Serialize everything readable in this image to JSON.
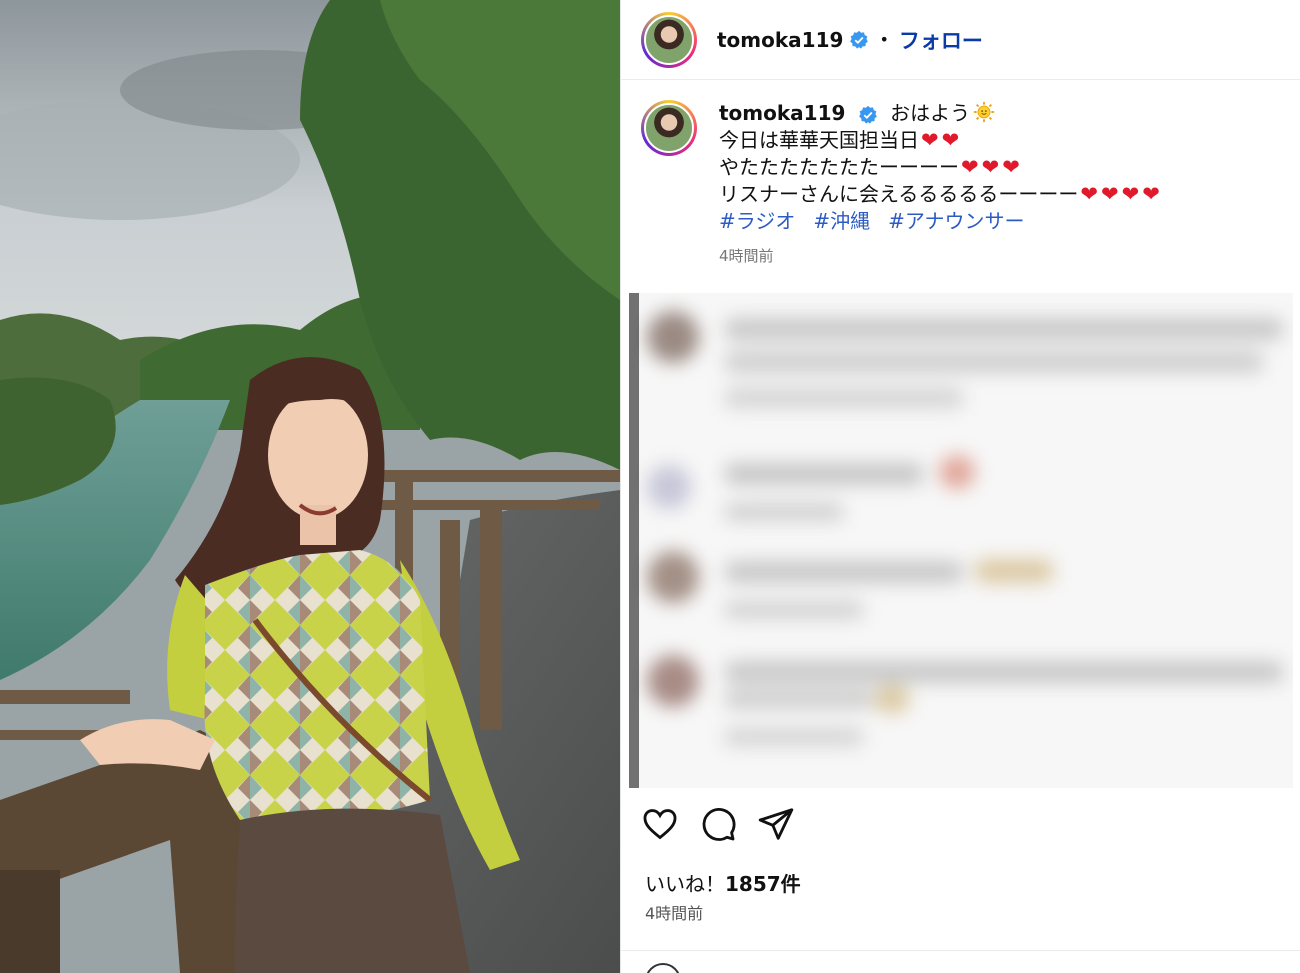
{
  "header": {
    "username": "tomoka119",
    "separator": "•",
    "follow_label": "フォロー"
  },
  "caption": {
    "username": "tomoka119",
    "lines": [
      "おはよう",
      "今日は華華天国担当日",
      "やたたたたたたたーーーー",
      "リスナーさんに会えるるるるるーーーー"
    ],
    "hearts": [
      "❤❤",
      "❤❤❤",
      "❤❤❤❤"
    ],
    "hashtags": [
      "#ラジオ",
      "#沖縄",
      "#アナウンサー"
    ],
    "time": "4時間前"
  },
  "engagement": {
    "likes_prefix": "いいね！",
    "likes_count": "1857件",
    "time": "4時間前"
  },
  "icons": [
    "verified-badge-icon",
    "sun-emoji-icon",
    "heart-icon",
    "comment-icon",
    "share-icon"
  ],
  "colors": {
    "follow": "#0a3aa8",
    "hashtag": "#2d5bc4",
    "heart": "#e0192b",
    "verified": "#3897f0"
  }
}
